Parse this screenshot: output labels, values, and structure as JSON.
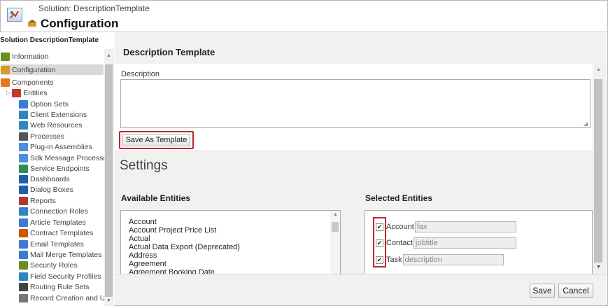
{
  "header": {
    "subtitle": "Solution: DescriptionTemplate",
    "title": "Configuration"
  },
  "nav": {
    "title": "Solution DescriptionTemplate",
    "items": [
      {
        "label": "Information",
        "icon": "information-icon",
        "color": "#6b8e23"
      },
      {
        "label": "Configuration",
        "icon": "configuration-icon",
        "color": "#d89b2a"
      },
      {
        "label": "Components",
        "icon": "components-icon",
        "color": "#e8761e"
      },
      {
        "label": "Entities",
        "icon": "entities-icon",
        "color": "#c0392b"
      },
      {
        "label": "Option Sets",
        "icon": "option-sets-icon",
        "color": "#3a7bd5"
      },
      {
        "label": "Client Extensions",
        "icon": "client-extensions-icon",
        "color": "#2e86c1"
      },
      {
        "label": "Web Resources",
        "icon": "web-resources-icon",
        "color": "#2e86c1"
      },
      {
        "label": "Processes",
        "icon": "processes-icon",
        "color": "#555555"
      },
      {
        "label": "Plug-in Assemblies",
        "icon": "plugin-assemblies-icon",
        "color": "#4a90d9"
      },
      {
        "label": "Sdk Message Processin...",
        "icon": "sdk-message-icon",
        "color": "#4a90d9"
      },
      {
        "label": "Service Endpoints",
        "icon": "service-endpoints-icon",
        "color": "#2e8b57"
      },
      {
        "label": "Dashboards",
        "icon": "dashboards-icon",
        "color": "#1f5fa8"
      },
      {
        "label": "Dialog Boxes",
        "icon": "dialog-boxes-icon",
        "color": "#1f5fa8"
      },
      {
        "label": "Reports",
        "icon": "reports-icon",
        "color": "#b03a2e"
      },
      {
        "label": "Connection Roles",
        "icon": "connection-roles-icon",
        "color": "#2e86c1"
      },
      {
        "label": "Article Templates",
        "icon": "article-templates-icon",
        "color": "#3a7bd5"
      },
      {
        "label": "Contract Templates",
        "icon": "contract-templates-icon",
        "color": "#d35400"
      },
      {
        "label": "Email Templates",
        "icon": "email-templates-icon",
        "color": "#3a7bd5"
      },
      {
        "label": "Mail Merge Templates",
        "icon": "mail-merge-icon",
        "color": "#3a7bd5"
      },
      {
        "label": "Security Roles",
        "icon": "security-roles-icon",
        "color": "#6b8e23"
      },
      {
        "label": "Field Security Profiles",
        "icon": "field-security-icon",
        "color": "#2e86c1"
      },
      {
        "label": "Routing Rule Sets",
        "icon": "routing-rule-icon",
        "color": "#444444"
      },
      {
        "label": "Record Creation and U...",
        "icon": "record-creation-icon",
        "color": "#777777"
      }
    ]
  },
  "main": {
    "section_title": "Description Template",
    "description_label": "Description",
    "description_value": "",
    "save_template_label": "Save As Template",
    "settings_title": "Settings",
    "available_title": "Available Entities",
    "selected_title": "Selected Entities",
    "available_entities": [
      "Account",
      "Account Project Price List",
      "Actual",
      "Actual Data Export (Deprecated)",
      "Address",
      "Agreement",
      "Agreement Booking Date"
    ],
    "selected_entities": [
      {
        "entity": "Account",
        "field": "fax",
        "checked": "✔"
      },
      {
        "entity": "Contact",
        "field": "jobtitle",
        "checked": "✔"
      },
      {
        "entity": "Task",
        "field": "description",
        "checked": "✔"
      }
    ]
  },
  "footer": {
    "save_label": "Save",
    "cancel_label": "Cancel"
  },
  "colors": {
    "highlight_border": "#c0242f",
    "band_background": "#f1f1f1"
  }
}
